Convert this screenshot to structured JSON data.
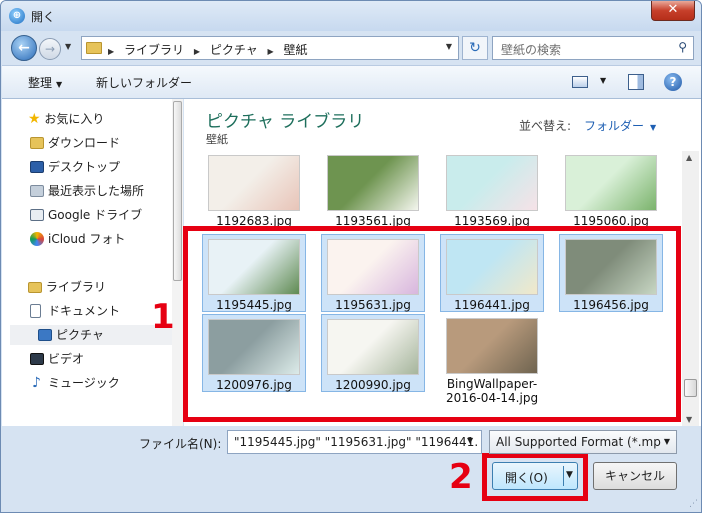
{
  "window": {
    "title": "開く",
    "close": "✕"
  },
  "address": {
    "crumbs": [
      "ライブラリ",
      "ピクチャ",
      "壁紙"
    ],
    "search_placeholder": "壁紙の検索"
  },
  "toolbar": {
    "organize": "整理",
    "new_folder": "新しいフォルダー"
  },
  "nav": {
    "favorites": "お気に入り",
    "favorites_items": [
      "ダウンロード",
      "デスクトップ",
      "最近表示した場所",
      "Google ドライブ",
      "iCloud フォト"
    ],
    "libraries": "ライブラリ",
    "library_items": [
      "ドキュメント",
      "ピクチャ",
      "ビデオ",
      "ミュージック"
    ]
  },
  "content": {
    "title": "ピクチャ ライブラリ",
    "subtitle": "壁紙",
    "arrange_label": "並べ替え:",
    "arrange_value": "フォルダー",
    "files": [
      {
        "name": "1192683.jpg",
        "selected": false,
        "color1": "#f3efe9",
        "color2": "#e8c4b8"
      },
      {
        "name": "1193561.jpg",
        "selected": false,
        "color1": "#6e9450",
        "color2": "#f4f6ee"
      },
      {
        "name": "1193569.jpg",
        "selected": false,
        "color1": "#c9ecec",
        "color2": "#f6e2e7"
      },
      {
        "name": "1195060.jpg",
        "selected": false,
        "color1": "#d9f0d8",
        "color2": "#7bb36c"
      },
      {
        "name": "1195445.jpg",
        "selected": true,
        "color1": "#e8f2f6",
        "color2": "#5f8a52"
      },
      {
        "name": "1195631.jpg",
        "selected": true,
        "color1": "#fbf3ef",
        "color2": "#d8b6de"
      },
      {
        "name": "1196441.jpg",
        "selected": true,
        "color1": "#bfe6f3",
        "color2": "#f1e8c9"
      },
      {
        "name": "1196456.jpg",
        "selected": true,
        "color1": "#7f8c7a",
        "color2": "#c7d6c3"
      },
      {
        "name": "1200976.jpg",
        "selected": true,
        "color1": "#8c9ea0",
        "color2": "#dcebe9"
      },
      {
        "name": "1200990.jpg",
        "selected": true,
        "color1": "#f6f6f1",
        "color2": "#a6b59c"
      },
      {
        "name": "BingWallpaper-2016-04-14.jpg",
        "line1": "BingWallpaper-",
        "line2": "2016-04-14.jpg",
        "selected": false,
        "color1": "#b89a7c",
        "color2": "#6f6450"
      }
    ]
  },
  "bottom": {
    "filename_label": "ファイル名(N):",
    "filename_value": "\"1195445.jpg\" \"1195631.jpg\" \"1196441.",
    "type_value": "All Supported Format (*.mp",
    "open_label": "開く(O)",
    "cancel_label": "キャンセル"
  },
  "annotations": {
    "step1": "1",
    "step2": "2",
    "highlight_color": "#e60012"
  }
}
